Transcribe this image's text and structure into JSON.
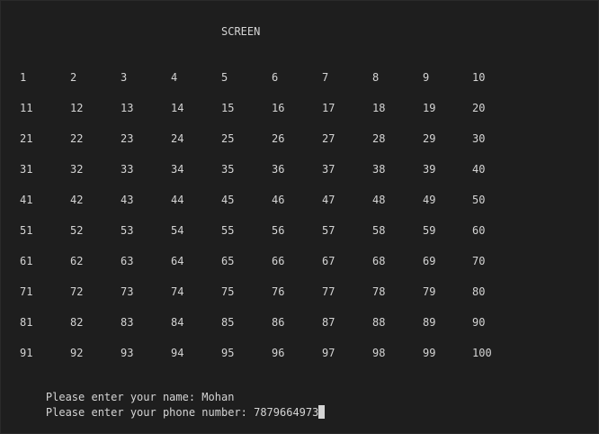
{
  "terminal": {
    "title": "SCREEN",
    "grid": [
      [
        "1",
        "2",
        "3",
        "4",
        "5",
        "6",
        "7",
        "8",
        "9",
        "10"
      ],
      [
        "11",
        "12",
        "13",
        "14",
        "15",
        "16",
        "17",
        "18",
        "19",
        "20"
      ],
      [
        "21",
        "22",
        "23",
        "24",
        "25",
        "26",
        "27",
        "28",
        "29",
        "30"
      ],
      [
        "31",
        "32",
        "33",
        "34",
        "35",
        "36",
        "37",
        "38",
        "39",
        "40"
      ],
      [
        "41",
        "42",
        "43",
        "44",
        "45",
        "46",
        "47",
        "48",
        "49",
        "50"
      ],
      [
        "51",
        "52",
        "53",
        "54",
        "55",
        "56",
        "57",
        "58",
        "59",
        "60"
      ],
      [
        "61",
        "62",
        "63",
        "64",
        "65",
        "66",
        "67",
        "68",
        "69",
        "70"
      ],
      [
        "71",
        "72",
        "73",
        "74",
        "75",
        "76",
        "77",
        "78",
        "79",
        "80"
      ],
      [
        "81",
        "82",
        "83",
        "84",
        "85",
        "86",
        "87",
        "88",
        "89",
        "90"
      ],
      [
        "91",
        "92",
        "93",
        "94",
        "95",
        "96",
        "97",
        "98",
        "99",
        "100"
      ]
    ],
    "lines": [
      "Please enter your name: Mohan",
      "Please enter your phone number: 7879664973"
    ]
  },
  "colors": {
    "background": "#1e1e1e",
    "text": "#d4d4d4"
  }
}
